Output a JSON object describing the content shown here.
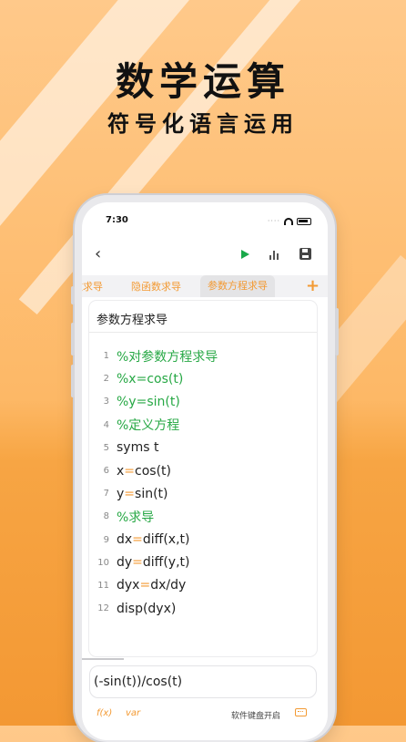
{
  "promo": {
    "headline": "数学运算",
    "subline": "符号化语言运用"
  },
  "status_bar": {
    "time": "7:30"
  },
  "toolbar": {
    "back_icon": "chevron-left-icon",
    "run_icon": "play-icon",
    "chart_icon": "bar-chart-icon",
    "save_icon": "save-icon"
  },
  "tabs": [
    {
      "label": "数求导"
    },
    {
      "label": "隐函数求导"
    },
    {
      "label": "参数方程求导",
      "active": true
    }
  ],
  "tab_add_label": "+",
  "editor": {
    "title": "参数方程求导",
    "lines": [
      {
        "num": "1",
        "pre": "",
        "op": "",
        "post": "%对参数方程求导"
      },
      {
        "num": "2",
        "pre": "",
        "op": "",
        "post": "%x=cos(t)"
      },
      {
        "num": "3",
        "pre": "",
        "op": "",
        "post": "%y=sin(t)"
      },
      {
        "num": "4",
        "pre": "",
        "op": "",
        "post": "%定义方程"
      },
      {
        "num": "5",
        "pre": "syms t",
        "op": "",
        "post": ""
      },
      {
        "num": "6",
        "pre": "x",
        "op": "=",
        "post": "cos(t)"
      },
      {
        "num": "7",
        "pre": "y",
        "op": "=",
        "post": "sin(t)"
      },
      {
        "num": "8",
        "pre": "",
        "op": "",
        "post": "%求导"
      },
      {
        "num": "9",
        "pre": "dx",
        "op": "=",
        "post": "diff(x,t)"
      },
      {
        "num": "10",
        "pre": "dy",
        "op": "=",
        "post": "diff(y,t)"
      },
      {
        "num": "11",
        "pre": "dyx",
        "op": "=",
        "post": "dx/dy"
      },
      {
        "num": "12",
        "pre": "disp(dyx)",
        "op": "",
        "post": ""
      }
    ]
  },
  "output": {
    "value": "(-sin(t))/cos(t)"
  },
  "bottom_bar": {
    "fx_label": "f(x)",
    "var_label": "var",
    "keyboard_label": "软件键盘开启",
    "keyboard_icon": "keyboard-icon"
  },
  "colors": {
    "accent": "#f39a33",
    "comment": "#27a845",
    "run": "#1aa84a"
  }
}
